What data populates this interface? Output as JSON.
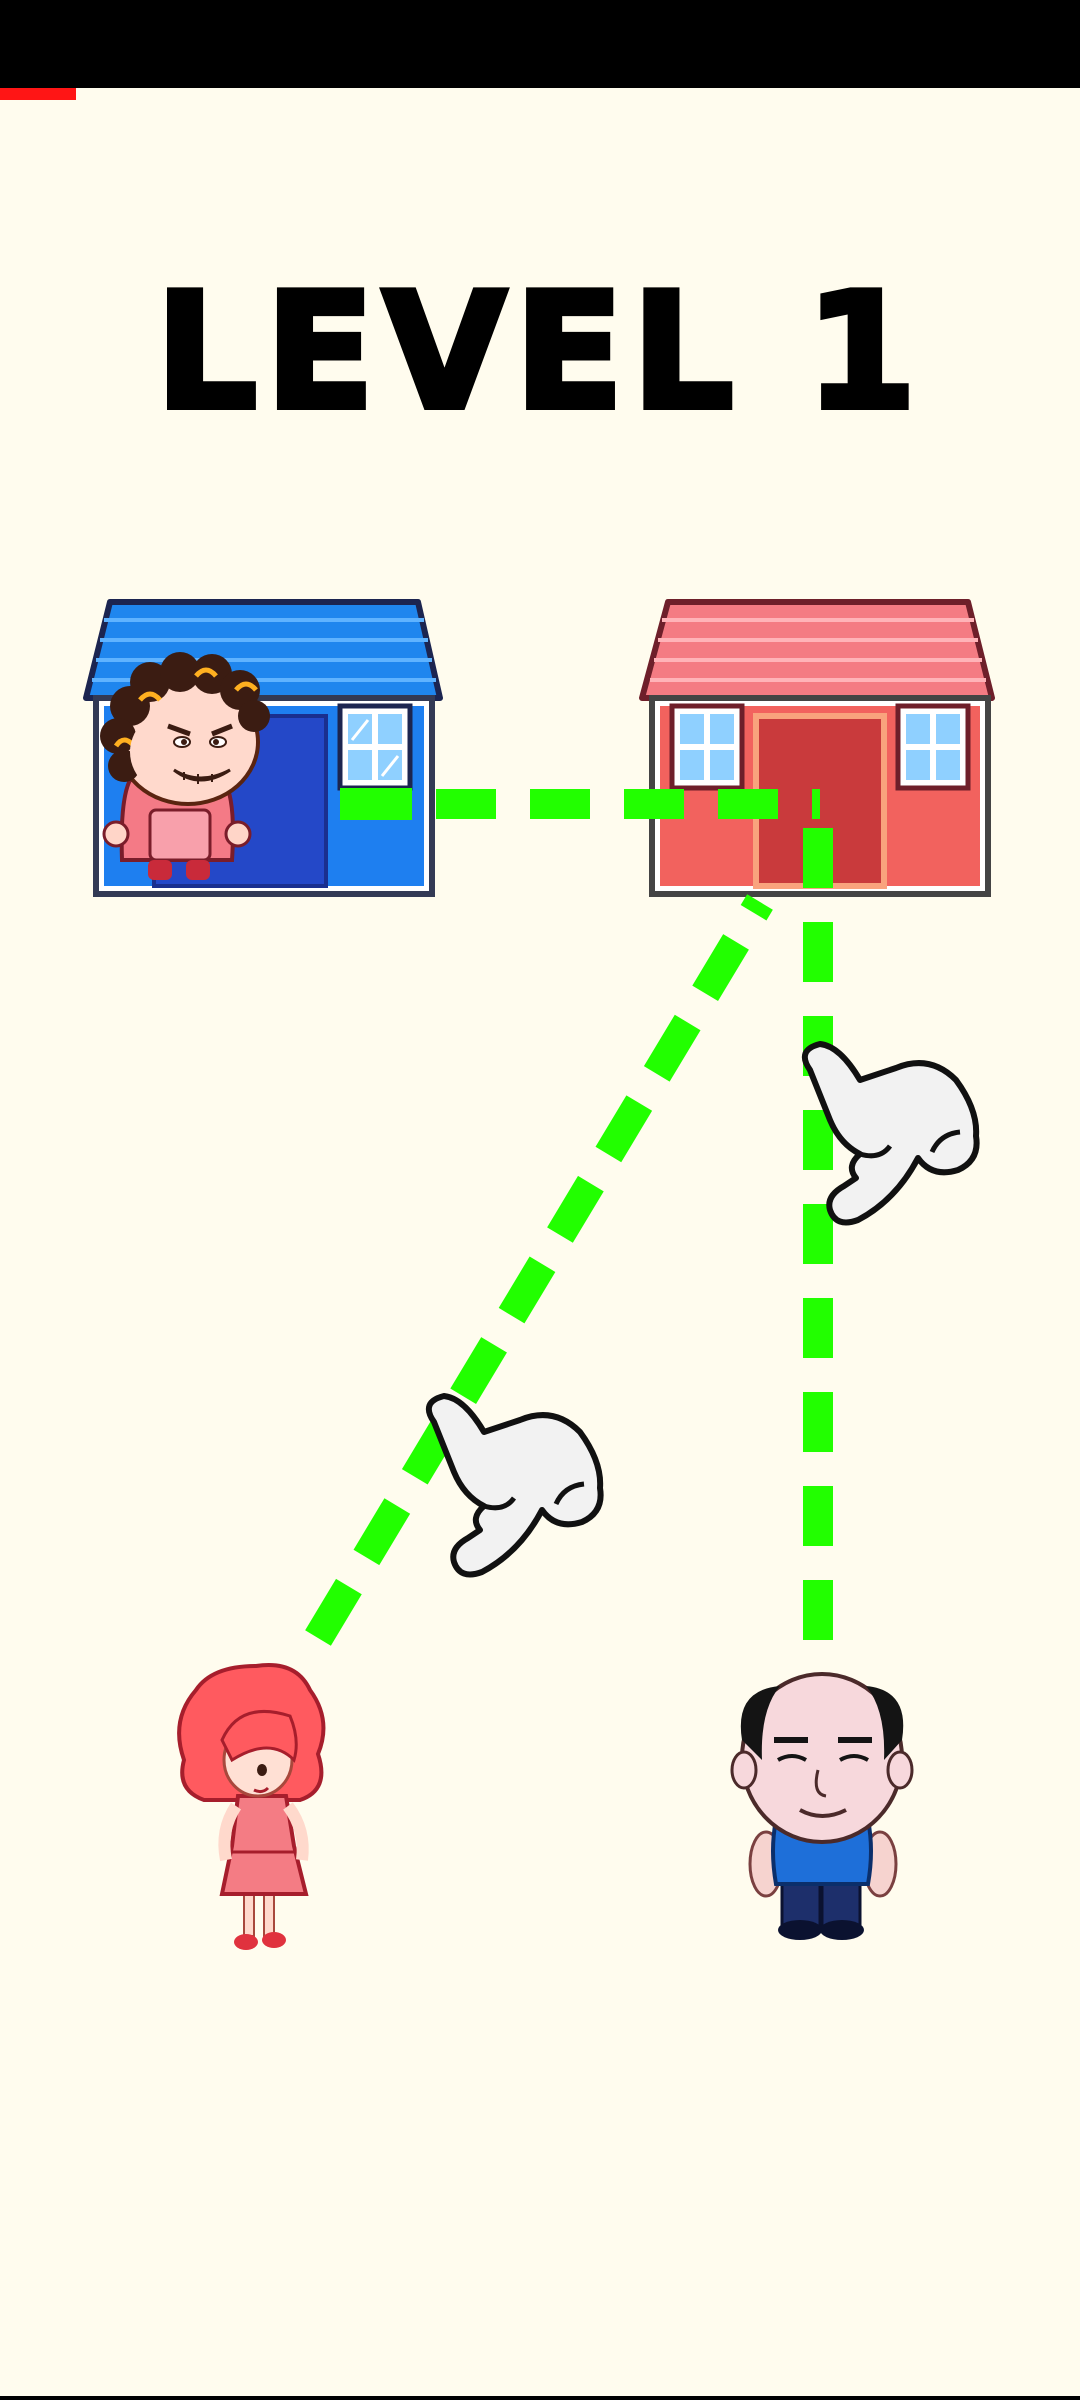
{
  "level": {
    "title": "LEVEL 1",
    "number": 1
  },
  "progress": {
    "fraction": 0.07
  },
  "colors": {
    "background": "#fffcee",
    "path": "#22ff00",
    "progress": "#ff1515",
    "blue_house": "#1b6fe8",
    "red_house": "#f25f5c"
  },
  "characters": [
    {
      "name": "old-woman",
      "location": "blue-house"
    },
    {
      "name": "young-woman",
      "location": "ground-left"
    },
    {
      "name": "bald-man",
      "location": "ground-right"
    }
  ],
  "hints": [
    {
      "icon": "pointing-hand-icon"
    },
    {
      "icon": "pointing-hand-icon"
    }
  ]
}
